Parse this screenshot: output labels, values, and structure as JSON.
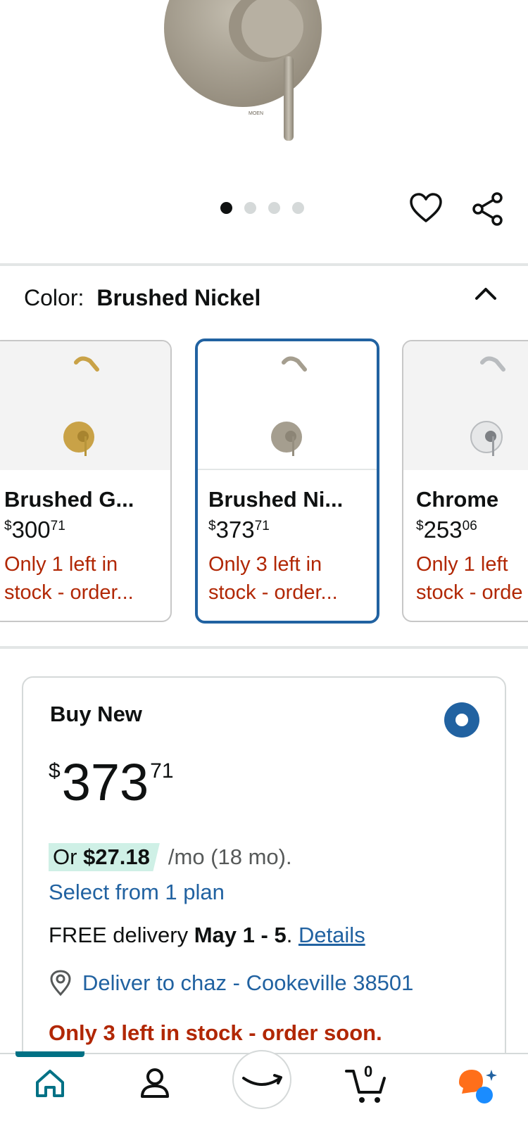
{
  "product": {
    "carousel_dots": 4,
    "active_dot": 0
  },
  "color_selector": {
    "label": "Color:",
    "value": "Brushed Nickel"
  },
  "swatches": [
    {
      "name": "Brushed G...",
      "price_symbol": "$",
      "price_whole": "300",
      "price_cents": "71",
      "stock_line1": "Only 1 left in",
      "stock_line2": "stock - order...",
      "finish_color": "#c9a247"
    },
    {
      "name": "Brushed Ni...",
      "price_symbol": "$",
      "price_whole": "373",
      "price_cents": "71",
      "stock_line1": "Only 3 left in",
      "stock_line2": "stock - order...",
      "finish_color": "#a59e8f"
    },
    {
      "name": "Chrome",
      "price_symbol": "$",
      "price_whole": "253",
      "price_cents": "06",
      "stock_line1": "Only 1 left",
      "stock_line2": "stock - orde",
      "finish_color": "#b9bcbf"
    }
  ],
  "buy_box": {
    "title": "Buy New",
    "price_symbol": "$",
    "price_whole": "373",
    "price_cents": "71",
    "monthly_prefix": "Or",
    "monthly_amount": "$27.18",
    "monthly_suffix": "/mo (18 mo).",
    "plan_link": "Select from 1 plan",
    "delivery_prefix": "FREE delivery",
    "delivery_dates": "May 1 - 5",
    "delivery_sep": ".",
    "delivery_details": "Details",
    "deliver_to": "Deliver to chaz - Cookeville 38501",
    "stock_message": "Only 3 left in stock - order soon."
  },
  "bottom_nav": {
    "cart_count": "0"
  },
  "colors": {
    "link": "#2162a1",
    "stock_red": "#b12704",
    "selected_border": "#2162a1",
    "finance_highlight": "#cff0e6",
    "nav_teal": "#007185"
  }
}
